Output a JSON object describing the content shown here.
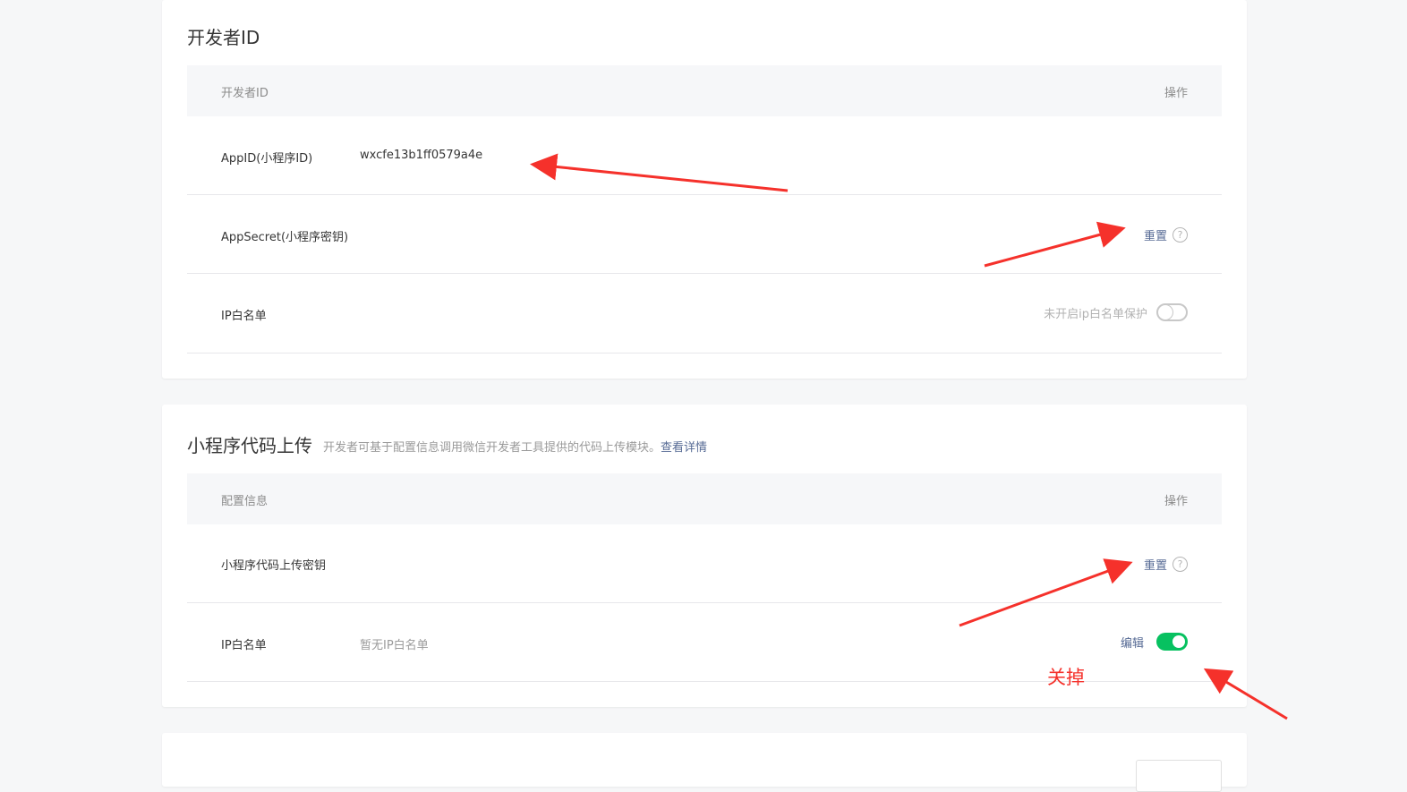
{
  "developer_id": {
    "title": "开发者ID",
    "header_left": "开发者ID",
    "header_right": "操作",
    "appid_label": "AppID(小程序ID)",
    "appid_value": "wxcfe13b1ff0579a4e",
    "appsecret_label": "AppSecret(小程序密钥)",
    "appsecret_reset": "重置",
    "ip_label": "IP白名单",
    "ip_status": "未开启ip白名单保护",
    "ip_toggle_on": false
  },
  "code_upload": {
    "title": "小程序代码上传",
    "description": "开发者可基于配置信息调用微信开发者工具提供的代码上传模块。",
    "details_link": "查看详情",
    "header_left": "配置信息",
    "header_right": "操作",
    "key_label": "小程序代码上传密钥",
    "key_reset": "重置",
    "ip_label": "IP白名单",
    "ip_value": "暂无IP白名单",
    "ip_edit": "编辑",
    "ip_toggle_on": true
  },
  "icons": {
    "help": "?"
  },
  "annotation": {
    "text": "关掉",
    "color": "#f5312b"
  },
  "colors": {
    "link": "#576b95",
    "toggle_on": "#07c160"
  }
}
